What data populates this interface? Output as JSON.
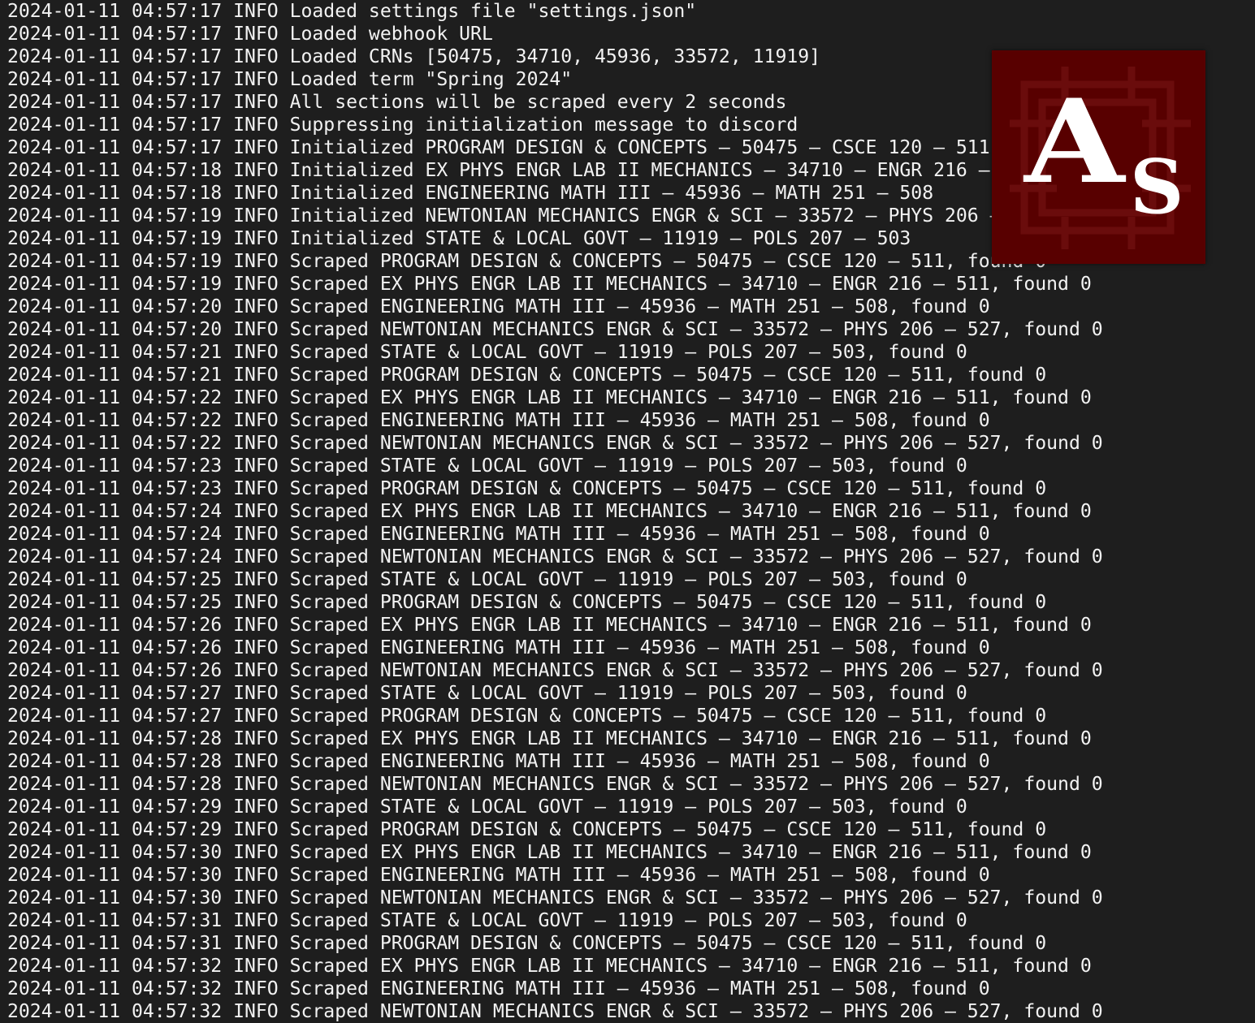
{
  "terminal": {
    "log_lines": [
      "2024-01-11 04:57:17 INFO Loaded settings file \"settings.json\"",
      "2024-01-11 04:57:17 INFO Loaded webhook URL",
      "2024-01-11 04:57:17 INFO Loaded CRNs [50475, 34710, 45936, 33572, 11919]",
      "2024-01-11 04:57:17 INFO Loaded term \"Spring 2024\"",
      "2024-01-11 04:57:17 INFO All sections will be scraped every 2 seconds",
      "2024-01-11 04:57:17 INFO Suppressing initialization message to discord",
      "2024-01-11 04:57:17 INFO Initialized PROGRAM DESIGN & CONCEPTS – 50475 – CSCE 120 – 511",
      "2024-01-11 04:57:18 INFO Initialized EX PHYS ENGR LAB II MECHANICS – 34710 – ENGR 216 – 511",
      "2024-01-11 04:57:18 INFO Initialized ENGINEERING MATH III – 45936 – MATH 251 – 508",
      "2024-01-11 04:57:19 INFO Initialized NEWTONIAN MECHANICS ENGR & SCI – 33572 – PHYS 206 – 527",
      "2024-01-11 04:57:19 INFO Initialized STATE & LOCAL GOVT – 11919 – POLS 207 – 503",
      "2024-01-11 04:57:19 INFO Scraped PROGRAM DESIGN & CONCEPTS – 50475 – CSCE 120 – 511, found 0",
      "2024-01-11 04:57:19 INFO Scraped EX PHYS ENGR LAB II MECHANICS – 34710 – ENGR 216 – 511, found 0",
      "2024-01-11 04:57:20 INFO Scraped ENGINEERING MATH III – 45936 – MATH 251 – 508, found 0",
      "2024-01-11 04:57:20 INFO Scraped NEWTONIAN MECHANICS ENGR & SCI – 33572 – PHYS 206 – 527, found 0",
      "2024-01-11 04:57:21 INFO Scraped STATE & LOCAL GOVT – 11919 – POLS 207 – 503, found 0",
      "2024-01-11 04:57:21 INFO Scraped PROGRAM DESIGN & CONCEPTS – 50475 – CSCE 120 – 511, found 0",
      "2024-01-11 04:57:22 INFO Scraped EX PHYS ENGR LAB II MECHANICS – 34710 – ENGR 216 – 511, found 0",
      "2024-01-11 04:57:22 INFO Scraped ENGINEERING MATH III – 45936 – MATH 251 – 508, found 0",
      "2024-01-11 04:57:22 INFO Scraped NEWTONIAN MECHANICS ENGR & SCI – 33572 – PHYS 206 – 527, found 0",
      "2024-01-11 04:57:23 INFO Scraped STATE & LOCAL GOVT – 11919 – POLS 207 – 503, found 0",
      "2024-01-11 04:57:23 INFO Scraped PROGRAM DESIGN & CONCEPTS – 50475 – CSCE 120 – 511, found 0",
      "2024-01-11 04:57:24 INFO Scraped EX PHYS ENGR LAB II MECHANICS – 34710 – ENGR 216 – 511, found 0",
      "2024-01-11 04:57:24 INFO Scraped ENGINEERING MATH III – 45936 – MATH 251 – 508, found 0",
      "2024-01-11 04:57:24 INFO Scraped NEWTONIAN MECHANICS ENGR & SCI – 33572 – PHYS 206 – 527, found 0",
      "2024-01-11 04:57:25 INFO Scraped STATE & LOCAL GOVT – 11919 – POLS 207 – 503, found 0",
      "2024-01-11 04:57:25 INFO Scraped PROGRAM DESIGN & CONCEPTS – 50475 – CSCE 120 – 511, found 0",
      "2024-01-11 04:57:26 INFO Scraped EX PHYS ENGR LAB II MECHANICS – 34710 – ENGR 216 – 511, found 0",
      "2024-01-11 04:57:26 INFO Scraped ENGINEERING MATH III – 45936 – MATH 251 – 508, found 0",
      "2024-01-11 04:57:26 INFO Scraped NEWTONIAN MECHANICS ENGR & SCI – 33572 – PHYS 206 – 527, found 0",
      "2024-01-11 04:57:27 INFO Scraped STATE & LOCAL GOVT – 11919 – POLS 207 – 503, found 0",
      "2024-01-11 04:57:27 INFO Scraped PROGRAM DESIGN & CONCEPTS – 50475 – CSCE 120 – 511, found 0",
      "2024-01-11 04:57:28 INFO Scraped EX PHYS ENGR LAB II MECHANICS – 34710 – ENGR 216 – 511, found 0",
      "2024-01-11 04:57:28 INFO Scraped ENGINEERING MATH III – 45936 – MATH 251 – 508, found 0",
      "2024-01-11 04:57:28 INFO Scraped NEWTONIAN MECHANICS ENGR & SCI – 33572 – PHYS 206 – 527, found 0",
      "2024-01-11 04:57:29 INFO Scraped STATE & LOCAL GOVT – 11919 – POLS 207 – 503, found 0",
      "2024-01-11 04:57:29 INFO Scraped PROGRAM DESIGN & CONCEPTS – 50475 – CSCE 120 – 511, found 0",
      "2024-01-11 04:57:30 INFO Scraped EX PHYS ENGR LAB II MECHANICS – 34710 – ENGR 216 – 511, found 0",
      "2024-01-11 04:57:30 INFO Scraped ENGINEERING MATH III – 45936 – MATH 251 – 508, found 0",
      "2024-01-11 04:57:30 INFO Scraped NEWTONIAN MECHANICS ENGR & SCI – 33572 – PHYS 206 – 527, found 0",
      "2024-01-11 04:57:31 INFO Scraped STATE & LOCAL GOVT – 11919 – POLS 207 – 503, found 0",
      "2024-01-11 04:57:31 INFO Scraped PROGRAM DESIGN & CONCEPTS – 50475 – CSCE 120 – 511, found 0",
      "2024-01-11 04:57:32 INFO Scraped EX PHYS ENGR LAB II MECHANICS – 34710 – ENGR 216 – 511, found 0",
      "2024-01-11 04:57:32 INFO Scraped ENGINEERING MATH III – 45936 – MATH 251 – 508, found 0",
      "2024-01-11 04:57:32 INFO Scraped NEWTONIAN MECHANICS ENGR & SCI – 33572 – PHYS 206 – 527, found 0"
    ],
    "colors": {
      "background": "#1e1e1e",
      "text": "#f2f2f2"
    }
  },
  "logo": {
    "letter_large": "A",
    "letter_small": "S",
    "colors": {
      "background": "#580000",
      "letters": "#ffffff"
    }
  }
}
